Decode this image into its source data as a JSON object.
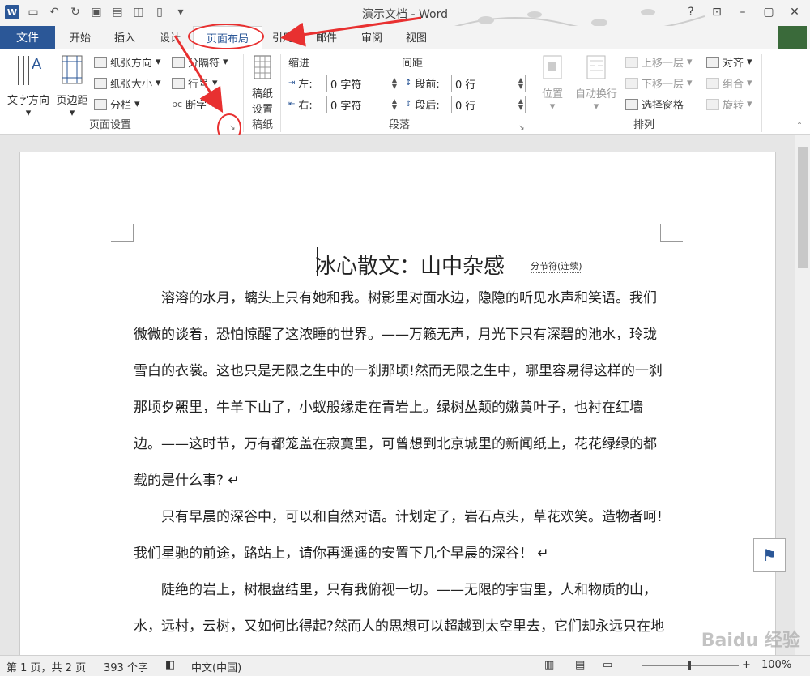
{
  "window": {
    "title": "演示文档 - Word",
    "help": "?"
  },
  "tabs": {
    "file": "文件",
    "home": "开始",
    "insert": "插入",
    "design": "设计",
    "layout": "页面布局",
    "references": "引用",
    "mailings": "邮件",
    "review": "审阅",
    "view": "视图"
  },
  "page_setup": {
    "text_direction": "文字方向",
    "margins": "页边距",
    "orientation": "纸张方向",
    "size": "纸张大小",
    "columns": "分栏",
    "breaks": "分隔符",
    "line_numbers": "行号",
    "hyphenation": "断字",
    "label": "页面设置"
  },
  "manuscript": {
    "btn_line1": "稿纸",
    "btn_line2": "设置",
    "label": "稿纸"
  },
  "paragraph": {
    "indent_title": "缩进",
    "spacing_title": "间距",
    "left_label": "左:",
    "left_value": "0 字符",
    "right_label": "右:",
    "right_value": "0 字符",
    "before_label": "段前:",
    "before_value": "0 行",
    "after_label": "段后:",
    "after_value": "0 行",
    "label": "段落"
  },
  "arrange": {
    "position": "位置",
    "wrap": "自动换行",
    "bring_forward": "上移一层",
    "send_backward": "下移一层",
    "selection_pane": "选择窗格",
    "align": "对齐",
    "group": "组合",
    "rotate": "旋转",
    "label": "排列"
  },
  "document": {
    "title": "冰心散文：山中杂感",
    "section_break": "分节符(连续)",
    "paragraphs": [
      "溶溶的水月，螭头上只有她和我。树影里对面水边，隐隐的听见水声和笑语。我们微微的谈着，恐怕惊醒了这浓睡的世界。——万籁无声，月光下只有深碧的池水，玲珑雪白的衣裳。这也只是无限之生中的一刹那顷!然而无限之生中，哪里容易得这样的一刹那顷！↵",
      "夕照里，牛羊下山了，小蚁般缘走在青岩上。绿树丛颠的嫩黄叶子，也衬在红墙边。——这时节，万有都笼盖在寂寞里，可曾想到北京城里的新闻纸上，花花绿绿的都载的是什么事? ↵",
      "只有早晨的深谷中，可以和自然对语。计划定了，岩石点头，草花欢笑。造物者呵!我们星驰的前途，路站上，请你再遥遥的安置下几个早晨的深谷！ ↵",
      "陡绝的岩上，树根盘结里，只有我俯视一切。——无限的宇宙里，人和物质的山，水，远村，云树，又如何比得起?然而人的思想可以超越到太空里去，它们却永远只在地面上"
    ]
  },
  "status": {
    "page": "第 1 页，共 2 页",
    "words": "393 个字",
    "language": "中文(中国)",
    "zoom": "100%"
  },
  "watermark": "Baidu 经验"
}
